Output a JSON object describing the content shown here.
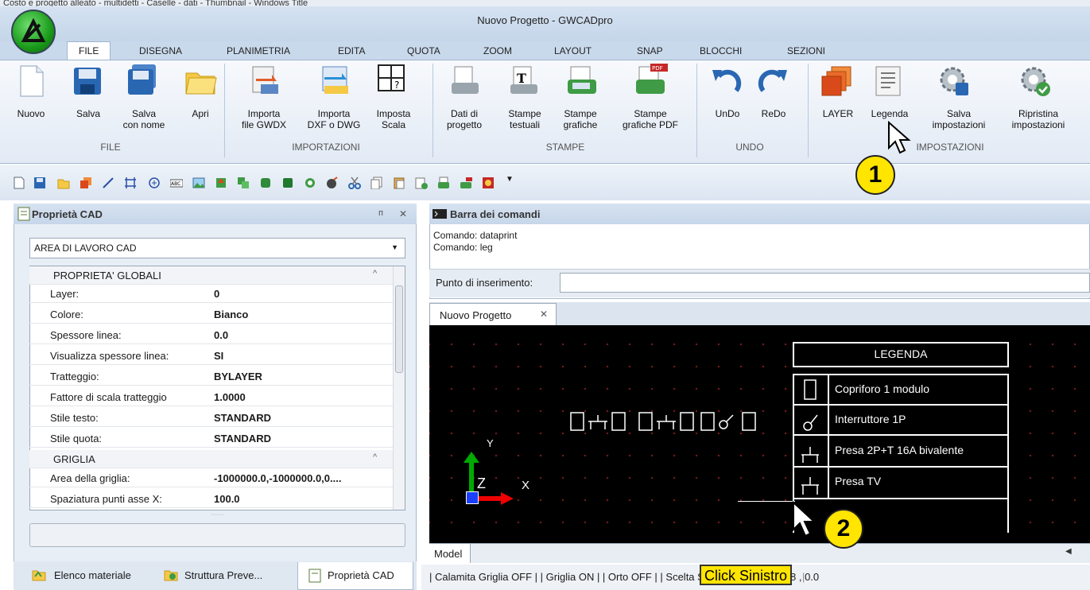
{
  "window": {
    "title": "Nuovo Progetto - GWCADpro",
    "top_fragment": "Costo e progetto alleato - multidetti - Caselle - dati - Thumbnail - Windows Title"
  },
  "tabs": [
    "FILE",
    "DISEGNA",
    "PLANIMETRIA",
    "EDITA",
    "QUOTA",
    "ZOOM",
    "LAYOUT",
    "SNAP",
    "BLOCCHI",
    "SEZIONI"
  ],
  "ribbon": {
    "file": [
      {
        "l1": "Nuovo",
        "l2": ""
      },
      {
        "l1": "Salva",
        "l2": ""
      },
      {
        "l1": "Salva",
        "l2": "con nome"
      },
      {
        "l1": "Apri",
        "l2": ""
      }
    ],
    "importazioni": [
      {
        "l1": "Importa",
        "l2": "file GWDX"
      },
      {
        "l1": "Importa",
        "l2": "DXF o DWG"
      },
      {
        "l1": "Imposta",
        "l2": "Scala"
      }
    ],
    "stampe": [
      {
        "l1": "Dati di",
        "l2": "progetto"
      },
      {
        "l1": "Stampe",
        "l2": "testuali"
      },
      {
        "l1": "Stampe",
        "l2": "grafiche"
      },
      {
        "l1": "Stampe",
        "l2": "grafiche PDF"
      }
    ],
    "undo": [
      {
        "l1": "UnDo",
        "l2": ""
      },
      {
        "l1": "ReDo",
        "l2": ""
      }
    ],
    "impostazioni": [
      {
        "l1": "LAYER",
        "l2": ""
      },
      {
        "l1": "Legenda",
        "l2": ""
      },
      {
        "l1": "Salva",
        "l2": "impostazioni"
      },
      {
        "l1": "Ripristina",
        "l2": "impostazioni"
      }
    ],
    "groups": [
      "FILE",
      "IMPORTAZIONI",
      "STAMPE",
      "UNDO",
      "IMPOSTAZIONI"
    ]
  },
  "left_panel": {
    "title": "Proprietà CAD",
    "pin": "ᴨ",
    "close": "✕",
    "select_value": "AREA DI LAVORO CAD",
    "cat1": "PROPRIETA' GLOBALI",
    "props": [
      {
        "n": "Layer:",
        "v": "0"
      },
      {
        "n": "Colore:",
        "v": "Bianco"
      },
      {
        "n": "Spessore linea:",
        "v": "0.0"
      },
      {
        "n": "Visualizza spessore linea:",
        "v": "SI"
      },
      {
        "n": "Tratteggio:",
        "v": "BYLAYER"
      },
      {
        "n": "Fattore di scala tratteggio",
        "v": "1.0000"
      },
      {
        "n": "Stile testo:",
        "v": "STANDARD"
      },
      {
        "n": "Stile quota:",
        "v": "STANDARD"
      }
    ],
    "cat2": "GRIGLIA",
    "props2": [
      {
        "n": "Area della griglia:",
        "v": "-1000000.0,-1000000.0,0...."
      },
      {
        "n": "Spaziatura punti asse X:",
        "v": "100.0"
      }
    ],
    "bottom_tabs": [
      "Elenco materiale",
      "Struttura Preve...",
      "Proprietà CAD"
    ]
  },
  "command": {
    "title": "Barra dei comandi",
    "lines": [
      "Comando: dataprint",
      "Comando: leg"
    ],
    "input_label": "Punto di inserimento:",
    "input_value": ""
  },
  "document": {
    "tab": "Nuovo Progetto",
    "model_tab": "Model"
  },
  "legend": {
    "title": "LEGENDA",
    "items": [
      "Copriforo 1 modulo",
      "Interruttore 1P",
      "Presa 2P+T 16A bivalente",
      "Presa TV"
    ]
  },
  "axes": {
    "y": "Y",
    "x": "X",
    "z": "Z"
  },
  "status": {
    "text": "| Calamita Griglia OFF | | Griglia ON | | Orto OFF | | Scelta S",
    "tail": "8 , 0.0",
    "callout": "Click Sinistro"
  },
  "badges": [
    "1",
    "2"
  ]
}
